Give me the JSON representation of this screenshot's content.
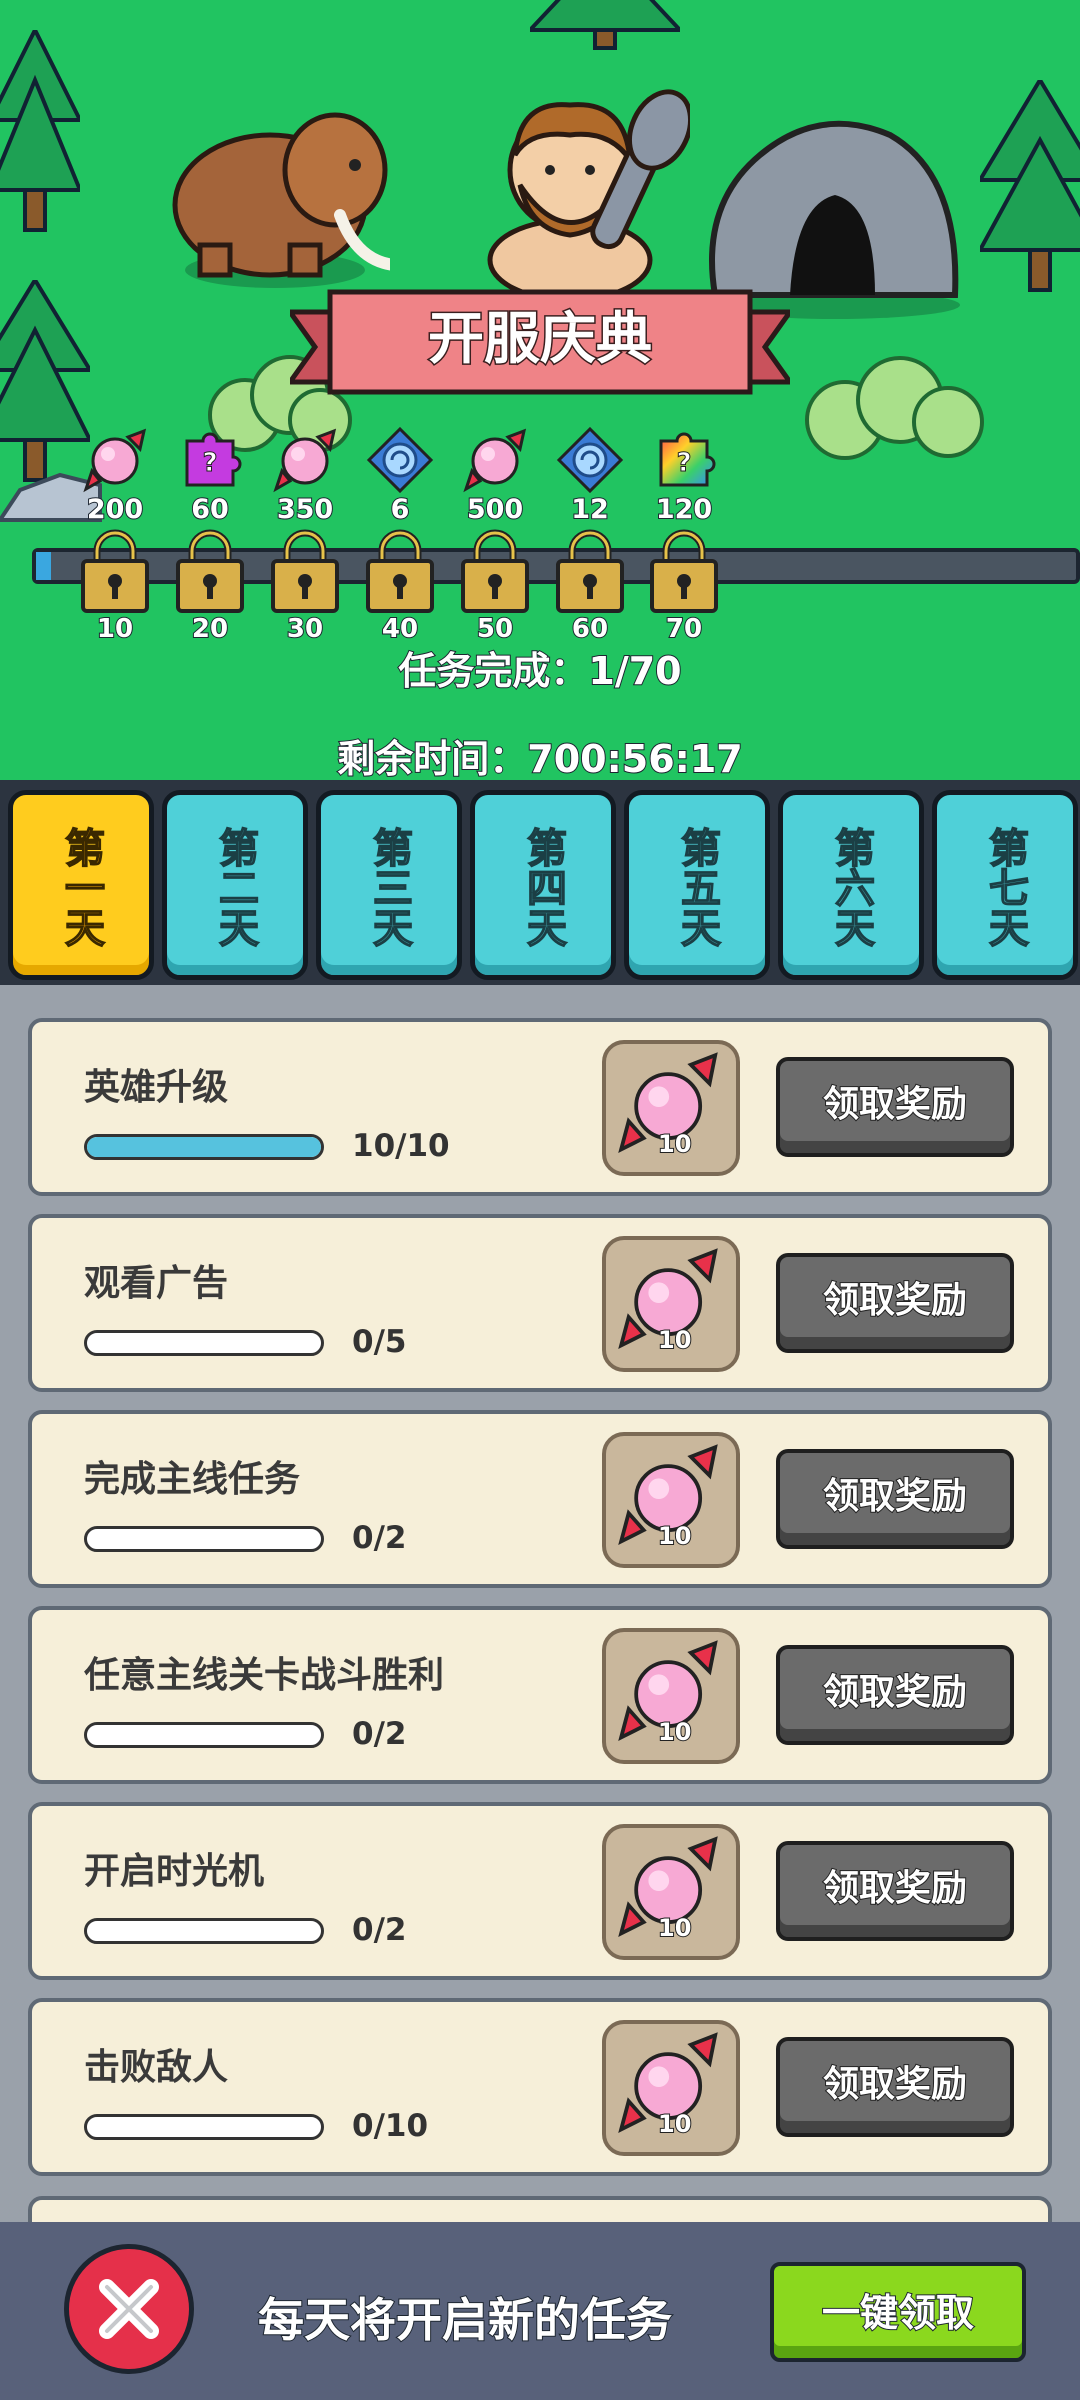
{
  "event_title": "开服庆典",
  "milestones": [
    {
      "reward_icon": "pink-candy-icon",
      "amount": "200",
      "level": "10"
    },
    {
      "reward_icon": "purple-puzzle-icon",
      "amount": "60",
      "level": "20"
    },
    {
      "reward_icon": "pink-candy-icon",
      "amount": "350",
      "level": "30"
    },
    {
      "reward_icon": "blue-swirl-gem-icon",
      "amount": "6",
      "level": "40"
    },
    {
      "reward_icon": "pink-candy-icon",
      "amount": "500",
      "level": "50"
    },
    {
      "reward_icon": "blue-swirl-gem-icon",
      "amount": "12",
      "level": "60"
    },
    {
      "reward_icon": "rainbow-puzzle-icon",
      "amount": "120",
      "level": "70"
    }
  ],
  "progress": {
    "label": "任务完成：",
    "current": "1",
    "total": "/70",
    "fraction": 0.014
  },
  "timer": {
    "label": "剩余时间：",
    "value": "700:56:17"
  },
  "tabs": [
    {
      "label": "第一天",
      "active": true
    },
    {
      "label": "第二天",
      "active": false
    },
    {
      "label": "第三天",
      "active": false
    },
    {
      "label": "第四天",
      "active": false
    },
    {
      "label": "第五天",
      "active": false
    },
    {
      "label": "第六天",
      "active": false
    },
    {
      "label": "第七天",
      "active": false
    }
  ],
  "tasks": [
    {
      "title": "英雄升级",
      "progress_text": "10/10",
      "progress": 1.0,
      "reward_amount": "10",
      "button": "领取奖励"
    },
    {
      "title": "观看广告",
      "progress_text": "0/5",
      "progress": 0,
      "reward_amount": "10",
      "button": "领取奖励"
    },
    {
      "title": "完成主线任务",
      "progress_text": "0/2",
      "progress": 0,
      "reward_amount": "10",
      "button": "领取奖励"
    },
    {
      "title": "任意主线关卡战斗胜利",
      "progress_text": "0/2",
      "progress": 0,
      "reward_amount": "10",
      "button": "领取奖励"
    },
    {
      "title": "开启时光机",
      "progress_text": "0/2",
      "progress": 0,
      "reward_amount": "10",
      "button": "领取奖励"
    },
    {
      "title": "击败敌人",
      "progress_text": "0/10",
      "progress": 0,
      "reward_amount": "10",
      "button": "领取奖励"
    }
  ],
  "footer": {
    "text": "每天将开启新的任务",
    "oneclick_label": "一键领取"
  },
  "colors": {
    "scene_green": "#21c461",
    "tab_active": "#ffcc1e",
    "tab_inactive": "#4fd0d8",
    "close_red": "#e5304a",
    "oneclick_green": "#8bd81e"
  }
}
